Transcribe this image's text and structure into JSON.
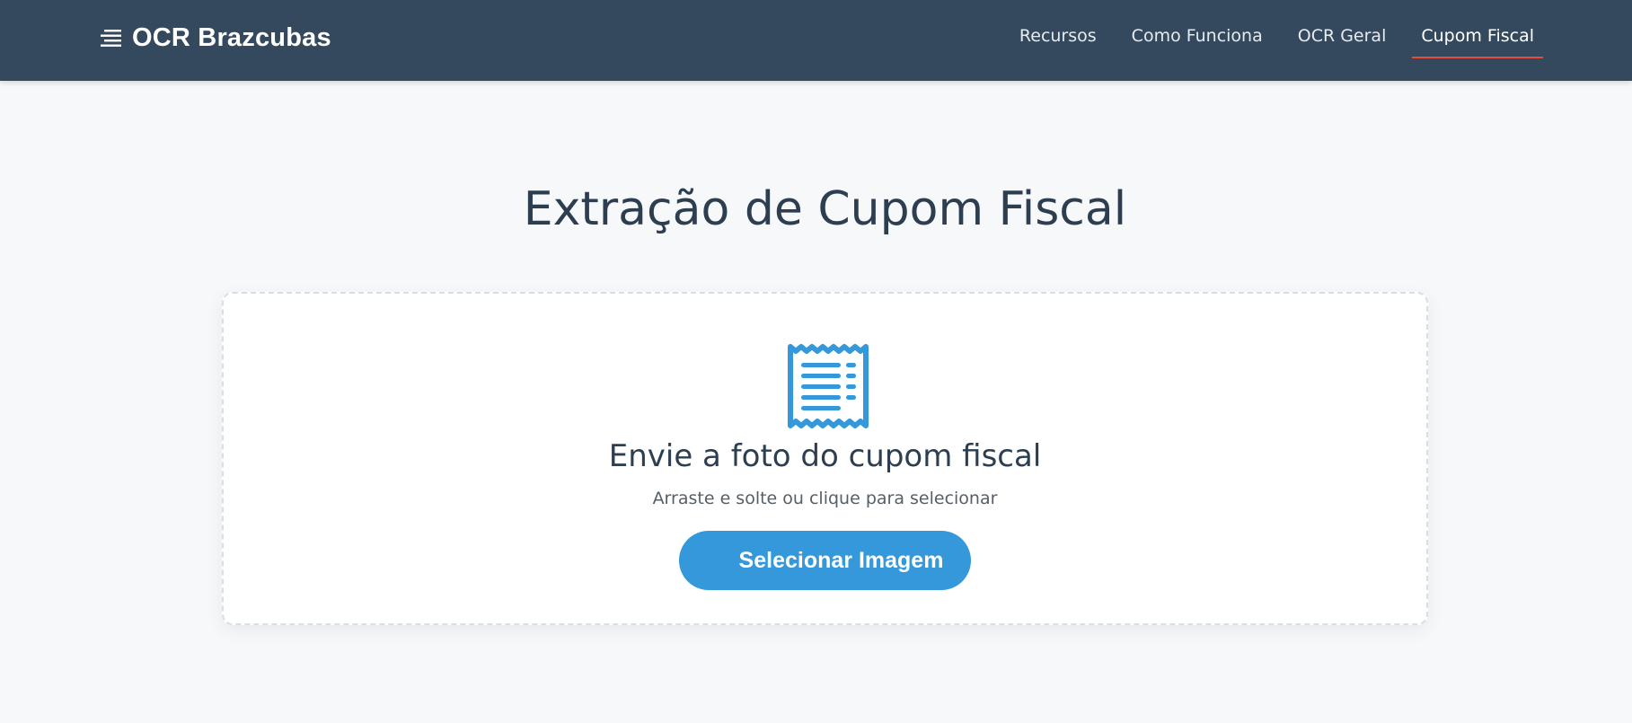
{
  "brand": {
    "name": "OCR Brazcubas",
    "icon": "align-left-icon"
  },
  "nav": {
    "items": [
      {
        "label": "Recursos",
        "active": false
      },
      {
        "label": "Como Funciona",
        "active": false
      },
      {
        "label": "OCR Geral",
        "active": false
      },
      {
        "label": "Cupom Fiscal",
        "active": true
      }
    ]
  },
  "main": {
    "title": "Extração de Cupom Fiscal",
    "upload": {
      "icon": "receipt-icon",
      "title": "Envie a foto do cupom fiscal",
      "subtitle": "Arraste e solte ou clique para selecionar",
      "button_label": "Selecionar Imagem"
    }
  },
  "colors": {
    "navbar_bg": "#34495e",
    "accent": "#3498db",
    "active_underline": "#e74c3c",
    "text_dark": "#2c3e50",
    "page_bg": "#f7f8fa"
  }
}
